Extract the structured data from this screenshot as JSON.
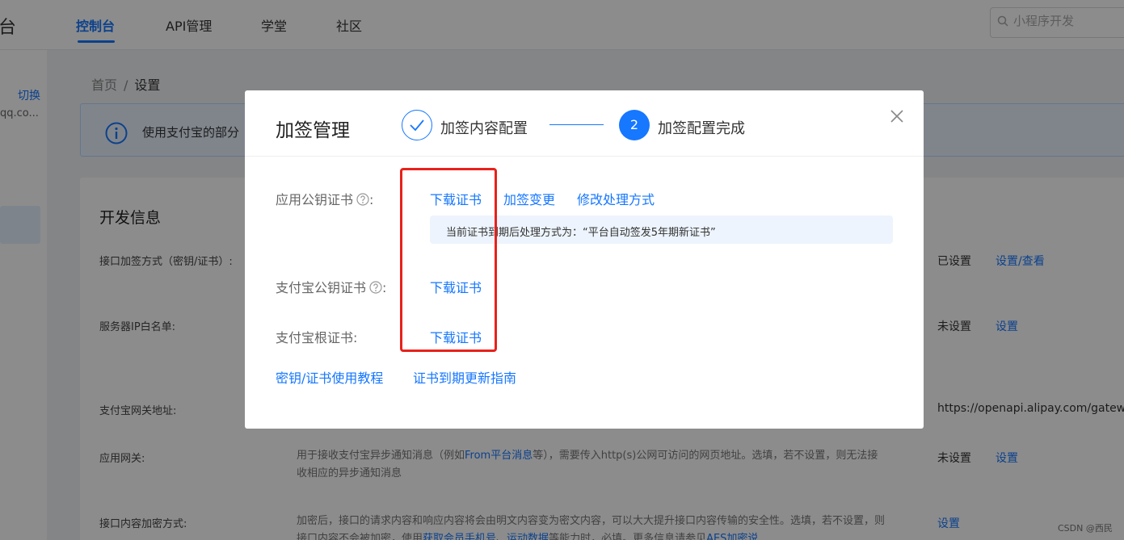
{
  "header": {
    "logo_fragment": "台",
    "tabs": [
      {
        "label": "控制台",
        "active": true
      },
      {
        "label": "API管理",
        "active": false
      },
      {
        "label": "学堂",
        "active": false
      },
      {
        "label": "社区",
        "active": false
      }
    ],
    "search_placeholder": "小程序开发"
  },
  "sidebar": {
    "switch_label": "切换",
    "account_fragment": "qq.co..."
  },
  "breadcrumb": {
    "home": "首页",
    "separator": "/",
    "current": "设置"
  },
  "notice": {
    "text": "使用支付宝的部分"
  },
  "dev_info": {
    "title": "开发信息",
    "rows": [
      {
        "label": "接口加签方式（密钥/证书）:",
        "status": "已设置",
        "action": "设置/查看"
      },
      {
        "label": "服务器IP白名单:",
        "status": "未设置",
        "action": "设置"
      },
      {
        "label": "支付宝网关地址:",
        "value": "https://openapi.alipay.com/gateway."
      },
      {
        "label": "应用网关:",
        "status": "未设置",
        "action": "设置",
        "desc_a": "用于接收支付宝异步通知消息（例如",
        "desc_link": "From平台消息",
        "desc_b": "等），需要传入http(s)公网可访问的网页地址。选填，若不设置，则无法接收相应的异步通知消息"
      },
      {
        "label": "接口内容加密方式:",
        "action": "设置",
        "desc_a": "加密后，接口的请求内容和响应内容将会由明文内容变为密文内容，可以大大提升接口内容传输的安全性。选填，",
        "desc_b": "若不设置，则接口内容不会被加密，使用",
        "desc_link1": "获取会员手机号",
        "desc_c": "、",
        "desc_link2": "运动数据",
        "desc_d": "等能力时，必填。更多信息请参见",
        "desc_link3": "AES加密说"
      }
    ]
  },
  "watermark": "CSDN @西民",
  "modal": {
    "title": "加签管理",
    "step1_label": "加签内容配置",
    "step2_number": "2",
    "step2_label": "加签配置完成",
    "app_cert_label": "应用公钥证书",
    "app_cert_colon": ":",
    "download_label": "下载证书",
    "change_sign_label": "加签变更",
    "modify_method_label": "修改处理方式",
    "expire_info": "当前证书到期后处理方式为：“平台自动签发5年期新证书”",
    "alipay_cert_label": "支付宝公钥证书",
    "alipay_cert_colon": ":",
    "root_cert_label": "支付宝根证书:",
    "tutorial_link": "密钥/证书使用教程",
    "renew_guide_link": "证书到期更新指南"
  },
  "colors": {
    "accent": "#1677ff",
    "highlight_box": "#e8211b"
  }
}
